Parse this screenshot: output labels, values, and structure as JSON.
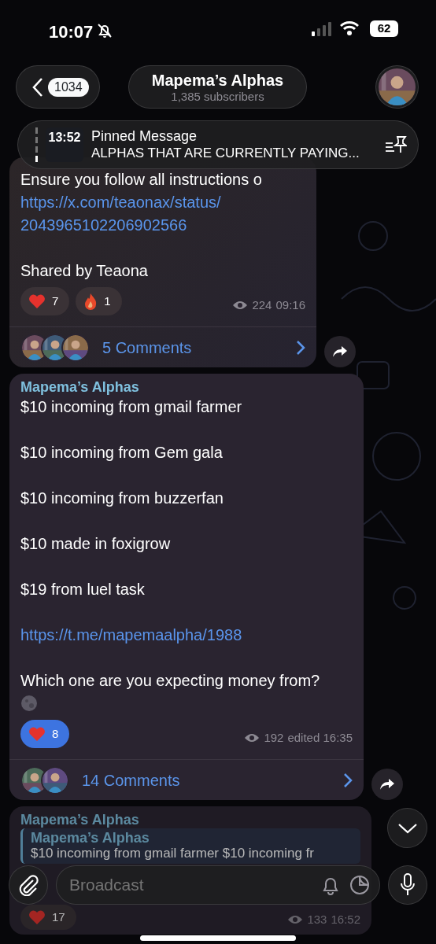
{
  "status_bar": {
    "time": "10:07",
    "battery": "62"
  },
  "header": {
    "back_count": "1034",
    "title": "Mapema’s Alphas",
    "subtitle": "1,385 subscribers"
  },
  "pinned": {
    "thumbnail_text": "13:52",
    "label": "Pinned Message",
    "text": "ALPHAS THAT ARE CURRENTLY PAYING..."
  },
  "messages": [
    {
      "lines": [
        {
          "kind": "text",
          "text": "Ensure you follow all instructions o"
        },
        {
          "kind": "link",
          "text": "https://x.com/teaonax/status/2043965102206902566"
        },
        {
          "kind": "spacer"
        },
        {
          "kind": "text",
          "text": "Shared by Teaona"
        }
      ],
      "reactions": [
        {
          "kind": "heart",
          "count": "7",
          "selected": false
        },
        {
          "kind": "fire",
          "count": "1",
          "selected": false
        }
      ],
      "views": "224",
      "time": "09:16",
      "comments": {
        "label": "5 Comments"
      },
      "forward_button": true
    },
    {
      "sender": "Mapema’s Alphas",
      "paragraphs": [
        {
          "kind": "text",
          "text": "$10 incoming from gmail farmer"
        },
        {
          "kind": "text",
          "text": "$10 incoming from Gem gala"
        },
        {
          "kind": "text",
          "text": "$10 incoming from buzzerfan"
        },
        {
          "kind": "text",
          "text": "$10 made in foxigrow"
        },
        {
          "kind": "text",
          "text": "$19 from luel task"
        },
        {
          "kind": "link",
          "text": "https://t.me/mapemaalpha/1988"
        },
        {
          "kind": "text",
          "text": "Which one are you expecting money from?"
        },
        {
          "kind": "moon_emoji"
        }
      ],
      "reactions": [
        {
          "kind": "heart",
          "count": "8",
          "selected": true
        }
      ],
      "views": "192",
      "time": "edited 16:35",
      "comments": {
        "label": "14 Comments"
      },
      "forward_button": true
    },
    {
      "sender": "Mapema’s Alphas",
      "quote": {
        "author": "Mapema’s Alphas",
        "text": "$10 incoming from gmail farmer $10 incoming fr"
      },
      "reactions": [
        {
          "kind": "heart",
          "count": "17",
          "selected": false
        }
      ],
      "views": "133",
      "time": "16:52",
      "forward_button": false
    }
  ],
  "composer": {
    "placeholder": "Broadcast"
  }
}
